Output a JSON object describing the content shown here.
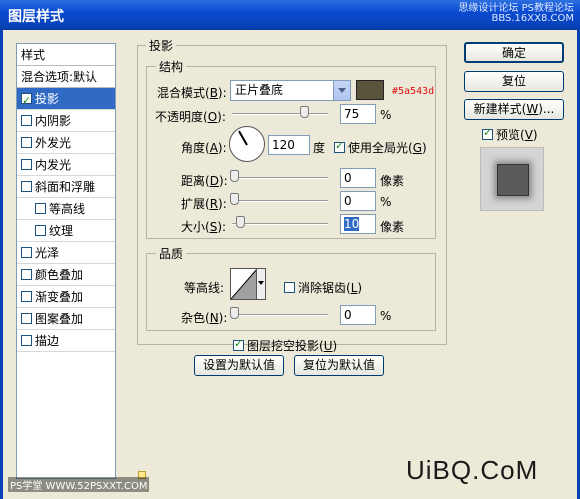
{
  "window": {
    "title": "图层样式",
    "watermark_line1": "思缘设计论坛 PS教程论坛",
    "watermark_line2": "BBS.16XX8.COM"
  },
  "sidebar": {
    "header": "样式",
    "blend": "混合选项:默认",
    "items": [
      {
        "label": "投影",
        "checked": true,
        "selected": true
      },
      {
        "label": "内阴影",
        "checked": false
      },
      {
        "label": "外发光",
        "checked": false
      },
      {
        "label": "内发光",
        "checked": false
      },
      {
        "label": "斜面和浮雕",
        "checked": false
      },
      {
        "label": "等高线",
        "checked": false,
        "indent": true
      },
      {
        "label": "纹理",
        "checked": false,
        "indent": true
      },
      {
        "label": "光泽",
        "checked": false
      },
      {
        "label": "颜色叠加",
        "checked": false
      },
      {
        "label": "渐变叠加",
        "checked": false
      },
      {
        "label": "图案叠加",
        "checked": false
      },
      {
        "label": "描边",
        "checked": false
      }
    ]
  },
  "drop_shadow": {
    "group_title": "投影",
    "structure_title": "结构",
    "blend_mode_label": "混合模式(",
    "blend_mode_key": "B",
    "blend_mode_value": "正片叠底",
    "color": "#5a543d",
    "color_label": "#5a543d",
    "opacity_label": "不透明度(",
    "opacity_key": "O",
    "opacity_value": "75",
    "opacity_pct": 0.75,
    "percent": "%",
    "angle_label": "角度(",
    "angle_key": "A",
    "angle_value": "120",
    "angle_unit": "度",
    "global_light_label": "使用全局光(",
    "global_light_key": "G",
    "global_light_checked": true,
    "distance_label": "距离(",
    "distance_key": "D",
    "distance_value": "0",
    "distance_unit": "像素",
    "spread_label": "扩展(",
    "spread_key": "R",
    "spread_value": "0",
    "size_label": "大小(",
    "size_key": "S",
    "size_value": "10",
    "size_unit": "像素",
    "quality_title": "品质",
    "contour_label": "等高线:",
    "antialias_label": "消除锯齿(",
    "antialias_key": "L",
    "noise_label": "杂色(",
    "noise_key": "N",
    "noise_value": "0",
    "knockout_label": "图层挖空投影(",
    "knockout_key": "U",
    "make_default": "设置为默认值",
    "reset_default": "复位为默认值"
  },
  "buttons": {
    "ok": "确定",
    "reset": "复位",
    "new_style": "新建样式(",
    "new_style_key": "W",
    "new_style_tail": ")...",
    "preview_label": "预览(",
    "preview_key": "V"
  },
  "footer": {
    "site": "PS学堂 WWW.52PSXXT.COM",
    "logo": "UiBQ.CoM"
  }
}
